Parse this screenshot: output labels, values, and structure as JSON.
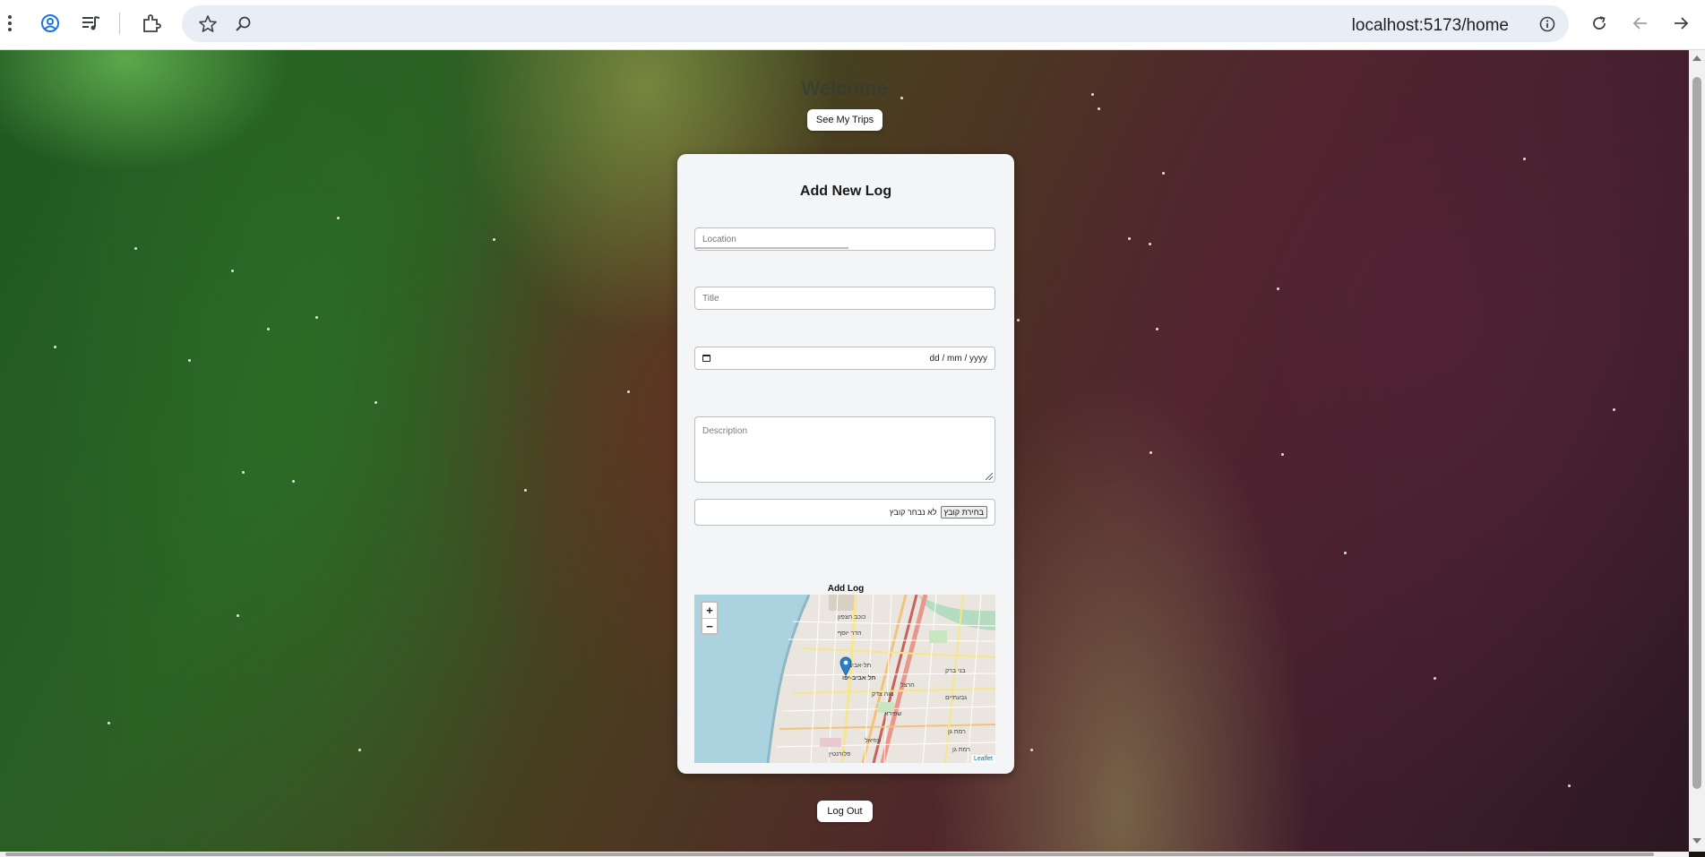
{
  "browser": {
    "url": "localhost:5173/home",
    "icons": [
      "menu-dots-icon",
      "profile-icon",
      "media-queue-icon",
      "extensions-icon",
      "star-icon",
      "zoom-search-icon",
      "site-info-icon",
      "reload-icon",
      "back-icon",
      "forward-icon"
    ]
  },
  "page": {
    "welcome": "Welcome",
    "see_trips_label": "See My Trips",
    "logout_label": "Log Out"
  },
  "form": {
    "title": "Add New Log",
    "location_placeholder": "Location",
    "title_placeholder": "Title",
    "date_placeholder": "dd / mm / yyyy",
    "description_placeholder": "Description",
    "file_button": "בחירת קובץ",
    "file_status": "לא נבחר קובץ",
    "submit_label": "Add Log"
  },
  "map": {
    "zoom_in": "+",
    "zoom_out": "−",
    "attribution": "Leaflet",
    "labels": [
      "כוכב הצפון",
      "תל אביב-יפו",
      "תל-אביב",
      "בני ברק",
      "רמת גן",
      "הרצל",
      "נווה צדק",
      "שפירא",
      "גבעתיים",
      "רמת גן",
      "הדר יוסף",
      "עוזיאל",
      "פלורנטין"
    ]
  },
  "colors": {
    "card_bg": "#f4f5f7",
    "map_sea": "#aad3df",
    "marker": "#2a81cb",
    "chrome_accent": "#1a73e8"
  }
}
